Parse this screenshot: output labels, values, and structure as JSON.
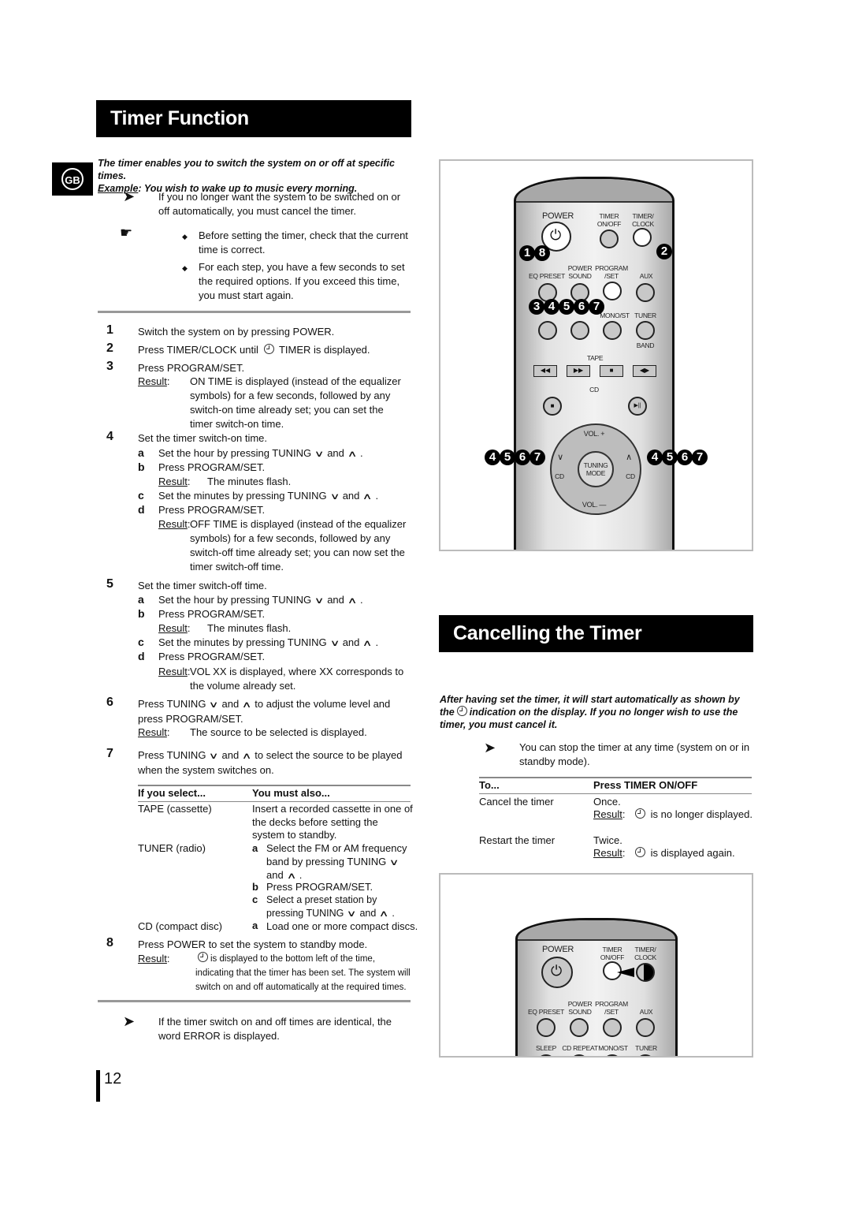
{
  "page_number": "12",
  "language_badge": "GB",
  "section1": {
    "title": "Timer Function",
    "intro_line1": "The timer enables you to switch the system on or off at specific times.",
    "intro_example_label": "Example",
    "intro_example_text": ": You wish to wake up to music every morning.",
    "note_arrow": "If you no longer want the system to be switched on or off automatically, you must cancel the timer.",
    "tips": [
      "Before setting the timer, check that the current time is correct.",
      "For each step, you have a few seconds to set the required options. If you exceed this time, you must start again."
    ],
    "steps": [
      {
        "num": "1",
        "text": "Switch the system on by pressing POWER."
      },
      {
        "num": "2",
        "text_before": "Press TIMER/CLOCK until",
        "text_after": "TIMER is displayed."
      },
      {
        "num": "3",
        "text": "Press PROGRAM/SET.",
        "result_label": "Result",
        "result": "ON TIME is displayed (instead of the equalizer symbols) for a few seconds, followed by any switch-on time already set; you can set the timer switch-on time."
      },
      {
        "num": "4",
        "text": "Set the timer switch-on time.",
        "subs": [
          {
            "letter": "a",
            "text": "Set the hour by pressing TUNING",
            "and": "and"
          },
          {
            "letter": "b",
            "text": "Press PROGRAM/SET.",
            "result_label": "Result",
            "result": "The minutes flash."
          },
          {
            "letter": "c",
            "text": "Set the minutes by pressing TUNING",
            "and": "and"
          },
          {
            "letter": "d",
            "text": "Press PROGRAM/SET.",
            "result_label": "Result",
            "result": "OFF TIME is displayed (instead of the equalizer symbols) for a few seconds, followed by any switch-off time already set; you can now set the timer switch-off time."
          }
        ]
      },
      {
        "num": "5",
        "text": "Set the timer switch-off time.",
        "subs": [
          {
            "letter": "a",
            "text": "Set the hour by pressing TUNING",
            "and": "and"
          },
          {
            "letter": "b",
            "text": "Press PROGRAM/SET.",
            "result_label": "Result",
            "result": "The minutes flash."
          },
          {
            "letter": "c",
            "text": "Set the minutes by pressing TUNING",
            "and": "and"
          },
          {
            "letter": "d",
            "text": "Press PROGRAM/SET.",
            "result_label": "Result",
            "result": "VOL XX is displayed, where XX corresponds to the volume already set."
          }
        ]
      },
      {
        "num": "6",
        "text_before": "Press TUNING",
        "and": "and",
        "text_after": "to adjust the volume level and press PROGRAM/SET.",
        "result_label": "Result",
        "result": "The source to be selected is displayed."
      },
      {
        "num": "7",
        "text_before": "Press TUNING",
        "and": "and",
        "text_after": "to select the source to be played when the system switches on."
      },
      {
        "num": "8",
        "text": "Press POWER to set the system to standby mode.",
        "result_label": "Result",
        "result": "is displayed to the bottom left of the time, indicating that the timer has been set. The system will switch on and off automatically at the required times."
      }
    ],
    "source_table": {
      "headers": [
        "If you select...",
        "You must also..."
      ],
      "rows": [
        {
          "source": "TAPE (cassette)",
          "action": "Insert a recorded cassette in one of the decks before setting the system to standby."
        },
        {
          "source": "TUNER (radio)",
          "actions": [
            {
              "letter": "a",
              "text": "Select the FM or AM frequency band by pressing TUNING",
              "and": "and"
            },
            {
              "letter": "b",
              "text": "Press PROGRAM/SET."
            },
            {
              "letter": "c",
              "text": "Select a preset station by pressing TUNING",
              "and": "and"
            }
          ]
        },
        {
          "source": "CD (compact disc)",
          "actions": [
            {
              "letter": "a",
              "text": "Load one or more compact discs."
            }
          ]
        }
      ]
    },
    "footer_note": "If the timer switch on and off times are identical, the word ERROR is displayed."
  },
  "remote_top": {
    "labels": {
      "power": "POWER",
      "timer_onoff": "TIMER ON/OFF",
      "timer_clock": "TIMER/ CLOCK",
      "eq_preset": "EQ PRESET",
      "power_sound": "POWER SOUND",
      "program_set": "PROGRAM /SET",
      "aux": "AUX",
      "mono_st": "MONO/ST",
      "tuner": "TUNER",
      "band": "BAND",
      "tape": "TAPE",
      "cd": "CD",
      "vol_plus": "VOL. +",
      "vol_minus": "VOL. —",
      "tuning_mode": "TUNING MODE",
      "cd_prev": "CD",
      "cd_next": "CD"
    },
    "step_badges": {
      "power": [
        "1",
        "8"
      ],
      "timer_clock": [
        "2"
      ],
      "program_set": [
        "3",
        "4",
        "5",
        "6",
        "7"
      ],
      "tuning_down": [
        "4",
        "5",
        "6",
        "7"
      ],
      "tuning_up": [
        "4",
        "5",
        "6",
        "7"
      ]
    }
  },
  "section2": {
    "title": "Cancelling the Timer",
    "intro_before": "After having set the timer, it will start automatically as shown by the",
    "intro_after": "indication on the display. If you no longer wish to use the timer, you must cancel it.",
    "note_arrow": "You can stop the timer at any time (system on or in standby mode).",
    "table": {
      "headers": [
        "To...",
        "Press TIMER ON/OFF"
      ],
      "rows": [
        {
          "to": "Cancel the timer",
          "press": "Once.",
          "result_label": "Result",
          "result": "is no longer displayed."
        },
        {
          "to": "Restart the timer",
          "press": "Twice.",
          "result_label": "Result",
          "result": "is displayed again."
        }
      ]
    }
  },
  "remote_bottom": {
    "labels": {
      "power": "POWER",
      "timer_onoff": "TIMER ON/OFF",
      "timer_clock": "TIMER/ CLOCK",
      "eq_preset": "EQ PRESET",
      "power_sound": "POWER SOUND",
      "program_set": "PROGRAM /SET",
      "aux": "AUX",
      "sleep": "SLEEP",
      "cd_repeat": "CD REPEAT",
      "mono_st": "MONO/ST",
      "tuner": "TUNER"
    }
  }
}
